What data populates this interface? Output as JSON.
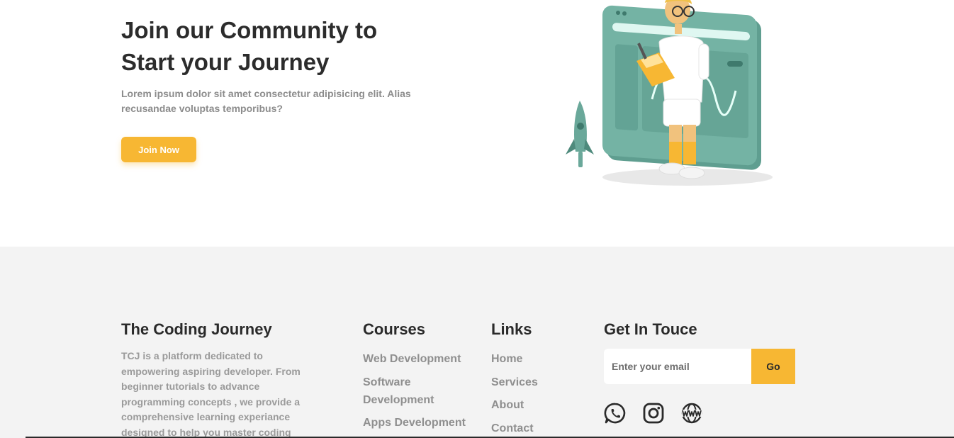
{
  "hero": {
    "title_line1": "Join our Community to",
    "title_line2": "Start your Journey",
    "description": "Lorem ipsum dolor sit amet consectetur adipisicing elit. Alias recusandae voluptas temporibus?",
    "join_label": "Join Now"
  },
  "footer": {
    "brand": {
      "title": "The Coding Journey",
      "description": "TCJ is a platform dedicated to empowering aspiring developer. From beginner tutorials to advance programming concepts , we provide a comprehensive learning experiance designed to help you master coding"
    },
    "courses": {
      "title": "Courses",
      "items": [
        "Web Development",
        "Software Development",
        "Apps Development"
      ]
    },
    "links": {
      "title": "Links",
      "items": [
        "Home",
        "Services",
        "About",
        "Contact"
      ]
    },
    "contact": {
      "title": "Get In Touce",
      "email_placeholder": "Enter your email",
      "go_label": "Go",
      "socials": [
        "whatsapp-icon",
        "instagram-icon",
        "globe-www-icon"
      ]
    }
  },
  "colors": {
    "accent": "#f7b733",
    "footer_bg": "#f3f3f3",
    "heading": "#2c2c2c",
    "muted": "#8f8f8f",
    "illustration_teal": "#6aa89a"
  }
}
